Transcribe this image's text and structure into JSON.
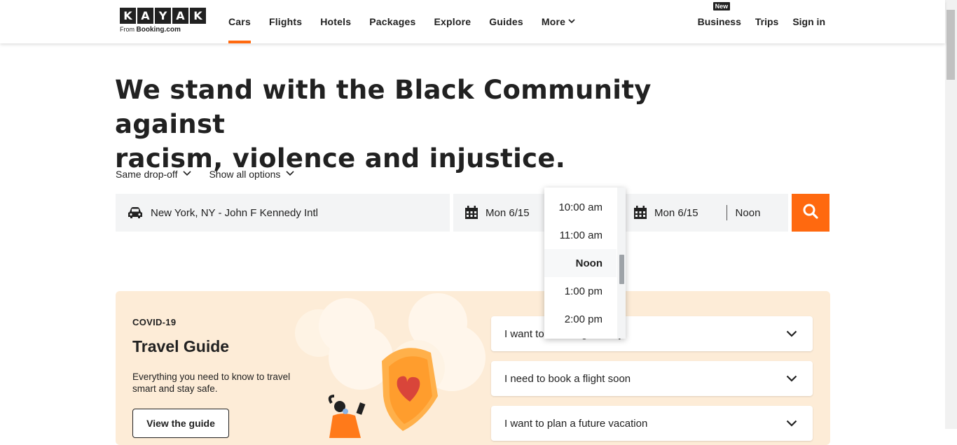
{
  "logo": {
    "letters": [
      "K",
      "A",
      "Y",
      "A",
      "K"
    ],
    "sub_prefix": "From",
    "sub_brand": "Booking.com"
  },
  "nav": {
    "items": [
      "Cars",
      "Flights",
      "Hotels",
      "Packages",
      "Explore",
      "Guides",
      "More"
    ],
    "active": "Cars"
  },
  "right_nav": {
    "business": "Business",
    "business_badge": "New",
    "trips": "Trips",
    "sign_in": "Sign in"
  },
  "hero": {
    "line1": "We stand with the Black Community against",
    "line2": "racism, violence and injustice."
  },
  "options": {
    "dropoff": "Same drop-off",
    "show_all": "Show all options"
  },
  "search": {
    "location": "New York, NY - John F Kennedy Intl",
    "pickup_date": "Mon 6/15",
    "dropoff_date": "Mon 6/15",
    "dropoff_time": "Noon"
  },
  "time_dropdown": {
    "options": [
      "10:00 am",
      "11:00 am",
      "Noon",
      "1:00 pm",
      "2:00 pm"
    ],
    "selected": "Noon"
  },
  "covid": {
    "kicker": "COVID-19",
    "title": "Travel Guide",
    "description": "Everything you need to know to travel smart and stay safe.",
    "button": "View the guide",
    "accordion": [
      "I want to travel right away",
      "I need to book a flight soon",
      "I want to plan a future vacation"
    ]
  },
  "colors": {
    "accent": "#ff690f",
    "dark": "#212121",
    "field_bg": "#f3f4f5",
    "covid_bg": "#fdecd7"
  }
}
